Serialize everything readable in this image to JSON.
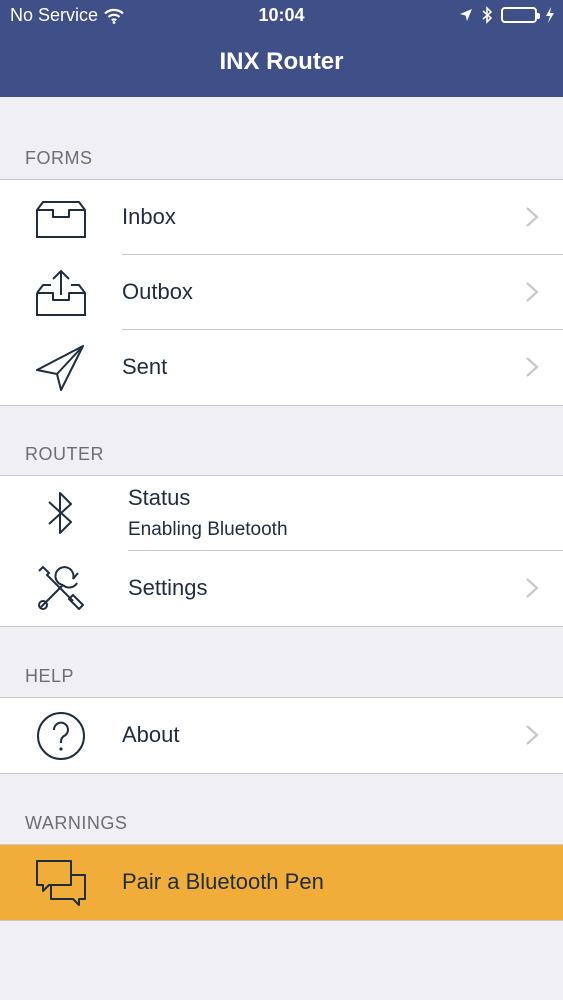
{
  "status_bar": {
    "carrier": "No Service",
    "time": "10:04"
  },
  "nav": {
    "title": "INX Router"
  },
  "sections": {
    "forms": {
      "header": "FORMS",
      "items": [
        {
          "label": "Inbox",
          "icon": "inbox-tray-icon"
        },
        {
          "label": "Outbox",
          "icon": "outbox-tray-icon"
        },
        {
          "label": "Sent",
          "icon": "paper-plane-icon"
        }
      ]
    },
    "router": {
      "header": "ROUTER",
      "status": {
        "title": "Status",
        "subtitle": "Enabling Bluetooth",
        "icon": "bluetooth-icon"
      },
      "settings": {
        "label": "Settings",
        "icon": "wrench-screwdriver-icon"
      }
    },
    "help": {
      "header": "HELP",
      "items": [
        {
          "label": "About",
          "icon": "question-circle-icon"
        }
      ]
    },
    "warnings": {
      "header": "WARNINGS",
      "items": [
        {
          "label": "Pair a Bluetooth Pen",
          "icon": "chat-bubbles-icon"
        }
      ]
    }
  },
  "colors": {
    "nav_bar": "#3f4f87",
    "background": "#efeff4",
    "warning_row": "#f0ad3a",
    "icon_stroke": "#1f2d3d"
  }
}
